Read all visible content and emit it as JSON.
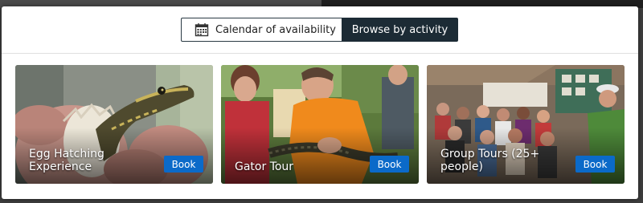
{
  "view_toggle": {
    "calendar_label": "Calendar of availability",
    "calendar_icon": "calendar-icon",
    "browse_label": "Browse by activity",
    "active": "browse"
  },
  "colors": {
    "toggle_active_bg": "#1c2b35",
    "book_button_bg": "#0b6ac9"
  },
  "activities": [
    {
      "title": "Egg Hatching Experience",
      "book_label": "Book"
    },
    {
      "title": "Gator Tour",
      "book_label": "Book"
    },
    {
      "title": "Group Tours (25+ people)",
      "book_label": "Book"
    }
  ]
}
